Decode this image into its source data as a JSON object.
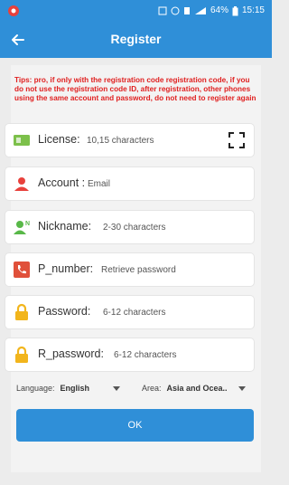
{
  "status_bar": {
    "battery": "64%",
    "time": "15:15"
  },
  "header": {
    "title": "Register"
  },
  "tips": "Tips: pro, if only with the registration code registration code, if you do not use the registration code ID, after registration, other phones using the same account and password, do not need to register again",
  "fields": {
    "license": {
      "label": "License:",
      "placeholder": "10,15 characters",
      "icon": "license-card-icon"
    },
    "account": {
      "label": "Account :",
      "placeholder": "Email",
      "icon": "person-icon"
    },
    "nickname": {
      "label": "Nickname:",
      "placeholder": "2-30 characters",
      "icon": "person-tag-icon"
    },
    "p_number": {
      "label": "P_number:",
      "placeholder": "Retrieve password",
      "icon": "phone-icon"
    },
    "password": {
      "label": "Password:",
      "placeholder": "6-12 characters",
      "icon": "lock-icon"
    },
    "r_password": {
      "label": "R_password:",
      "placeholder": "6-12 characters",
      "icon": "lock-icon"
    }
  },
  "language": {
    "label": "Language:",
    "value": "English"
  },
  "area": {
    "label": "Area:",
    "value": "Asia and Ocea.."
  },
  "ok_label": "OK",
  "colors": {
    "accent": "#2f8fd8",
    "tip_red": "#e02020",
    "license_green": "#7cc04a",
    "account_red": "#e8413c",
    "nickname_green": "#58b848",
    "phone_red": "#e0503a",
    "lock_yellow": "#f2b51c"
  }
}
